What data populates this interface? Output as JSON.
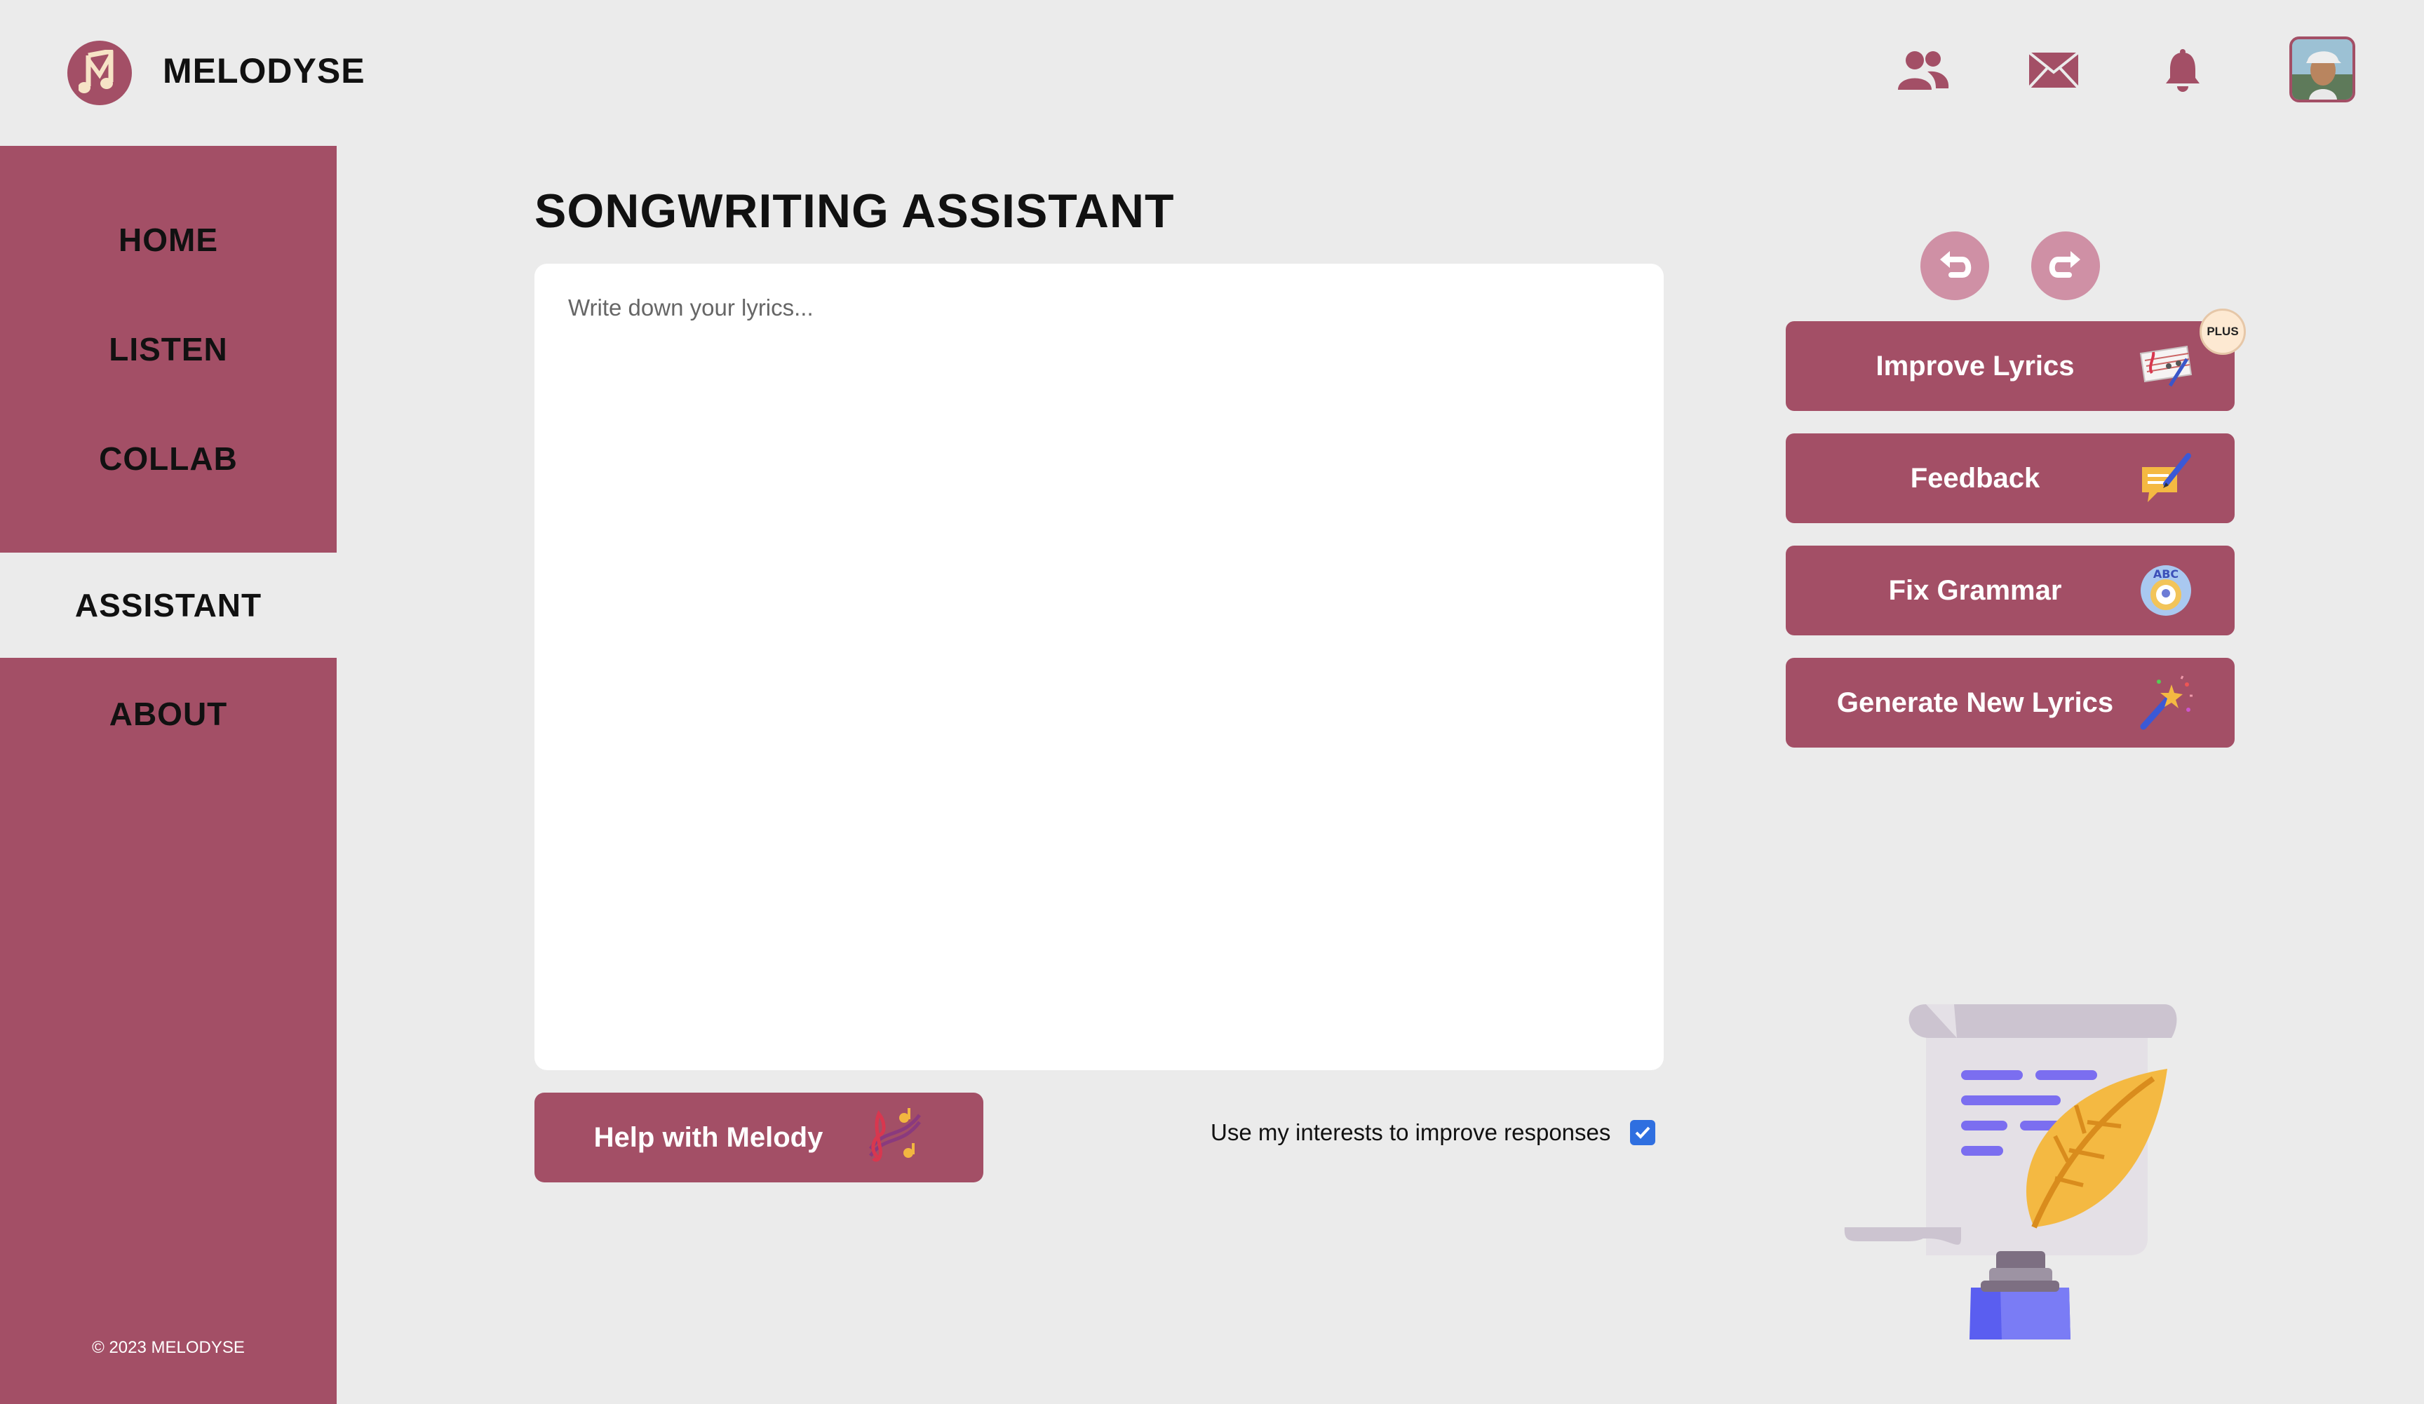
{
  "app": {
    "name": "MELODYSE"
  },
  "sidebar": {
    "items": [
      {
        "label": "HOME",
        "active": false
      },
      {
        "label": "LISTEN",
        "active": false
      },
      {
        "label": "COLLAB",
        "active": false
      },
      {
        "label": "ASSISTANT",
        "active": true
      },
      {
        "label": "ABOUT",
        "active": false
      }
    ],
    "copyright": "© 2023 MELODYSE"
  },
  "header": {
    "icons": [
      "people-icon",
      "mail-icon",
      "bell-icon",
      "avatar"
    ]
  },
  "main": {
    "title": "SONGWRITING ASSISTANT",
    "editor": {
      "placeholder": "Write down your lyrics...",
      "value": ""
    },
    "melody_button": {
      "label": "Help with Melody",
      "icon": "music-notes-icon"
    },
    "interests": {
      "label": "Use my interests to improve responses",
      "checked": true
    }
  },
  "actions": {
    "undo_icon": "undo-icon",
    "redo_icon": "redo-icon",
    "buttons": [
      {
        "label": "Improve Lyrics",
        "icon": "sheet-music-icon",
        "badge": "PLUS"
      },
      {
        "label": "Feedback",
        "icon": "feedback-icon"
      },
      {
        "label": "Fix Grammar",
        "icon": "abc-icon"
      },
      {
        "label": "Generate New Lyrics",
        "icon": "magic-wand-icon"
      }
    ]
  },
  "colors": {
    "accent": "#a34f66",
    "background": "#ebebeb",
    "accent_light": "#cf90a5"
  }
}
